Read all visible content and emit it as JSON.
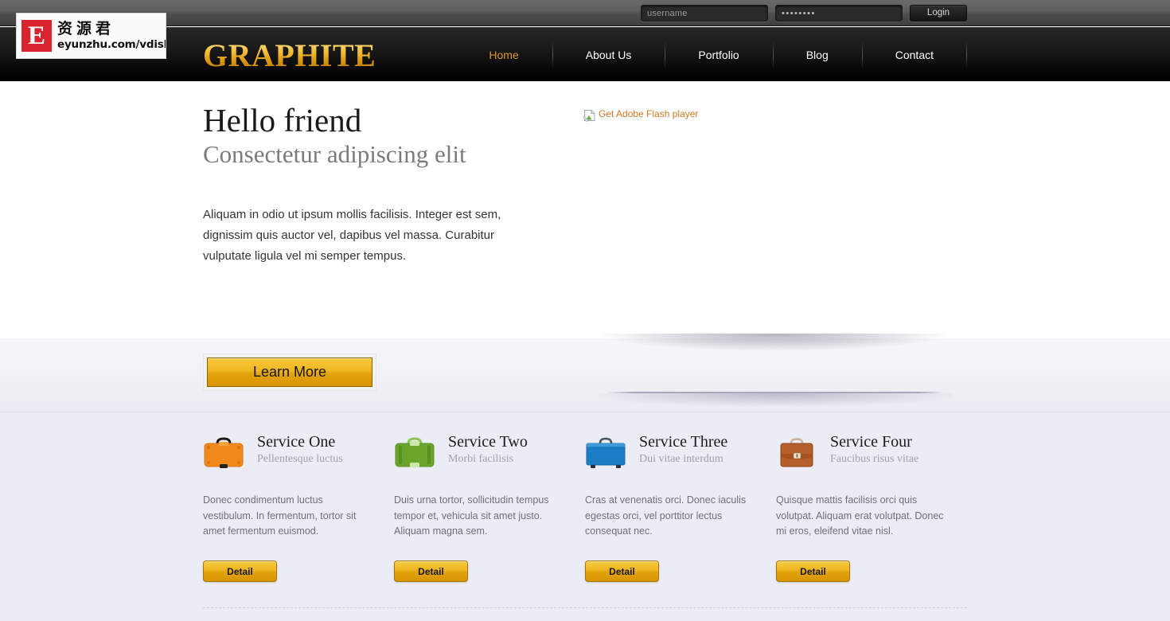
{
  "topbar": {
    "username_placeholder": "username",
    "username_value": "",
    "password_value": "••••••••",
    "login_label": "Login"
  },
  "watermark": {
    "letter": "E",
    "chinese": "资源君",
    "url": "eyunzhu.com/vdisk"
  },
  "nav": {
    "brand": "GRAPHITE",
    "brand_color": "#e0a320",
    "active_color": "#d99a22",
    "items": [
      {
        "label": "Home",
        "active": true
      },
      {
        "label": "About Us",
        "active": false
      },
      {
        "label": "Portfolio",
        "active": false
      },
      {
        "label": "Blog",
        "active": false
      },
      {
        "label": "Contact",
        "active": false
      }
    ]
  },
  "hero": {
    "heading": "Hello friend",
    "subheading": "Consectetur adipiscing elit",
    "paragraph": "Aliquam in odio ut ipsum mollis facilisis. Integer est sem, dignissim quis auctor vel, dapibus vel massa. Curabitur vulputate ligula vel mi semper tempus.",
    "flash_alt": "Get Adobe Flash player",
    "flash_alt_color": "#cc7722",
    "learn_more_label": "Learn More"
  },
  "services": {
    "detail_label": "Detail",
    "items": [
      {
        "title": "Service One",
        "subtitle": "Pellentesque luctus",
        "body": "Donec condimentum luctus vestibulum. In fermentum, tortor sit amet fermentum euismod.",
        "icon": "briefcase-icon",
        "icon_color": "#f08a1c"
      },
      {
        "title": "Service Two",
        "subtitle": "Morbi facilisis",
        "body": "Duis urna tortor, sollicitudin tempus tempor et, vehicula sit amet justo. Aliquam magna sem.",
        "icon": "briefcase-icon",
        "icon_color": "#6aa52b"
      },
      {
        "title": "Service Three",
        "subtitle": "Dui vitae interdum",
        "body": "Cras at venenatis orci. Donec iaculis egestas orci, vel porttitor lectus consequat nec.",
        "icon": "briefcase-icon",
        "icon_color": "#1b7ec4"
      },
      {
        "title": "Service Four",
        "subtitle": "Faucibus risus vitae",
        "body": "Quisque mattis facilisis orci quis volutpat. Aliquam erat volutpat. Donec mi eros, eleifend vitae nisl.",
        "icon": "briefcase-icon",
        "icon_color": "#b5602a"
      }
    ]
  }
}
